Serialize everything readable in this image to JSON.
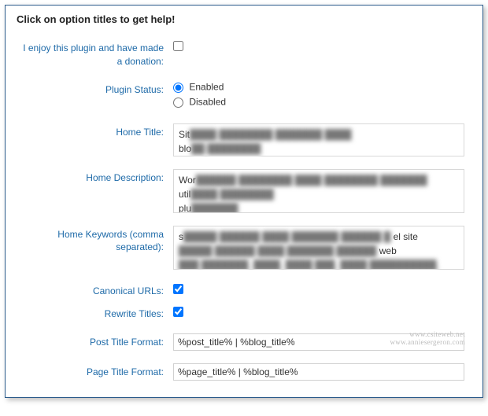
{
  "header": {
    "title": "Click on option titles to get help!"
  },
  "rows": {
    "donation": {
      "label": "I enjoy this plugin and have made a donation:",
      "checked": false
    },
    "plugin_status": {
      "label": "Plugin Status:",
      "options": {
        "enabled": "Enabled",
        "disabled": "Disabled"
      },
      "value": "enabled"
    },
    "home_title": {
      "label": "Home Title:",
      "value_preview": "Sit",
      "value_line2": "blo"
    },
    "home_description": {
      "label": "Home Description:",
      "value_preview": "Wor",
      "value_line2": "util",
      "value_line3": "plu"
    },
    "home_keywords": {
      "label": "Home Keywords (comma separated):",
      "value_preview": "s",
      "suffix1": "el site",
      "suffix2": "web"
    },
    "canonical": {
      "label": "Canonical URLs:",
      "checked": true
    },
    "rewrite": {
      "label": "Rewrite Titles:",
      "checked": true
    },
    "post_title_format": {
      "label": "Post Title Format:",
      "value": "%post_title% | %blog_title%"
    },
    "page_title_format": {
      "label": "Page Title Format:",
      "value": "%page_title% | %blog_title%"
    }
  },
  "watermark": {
    "line1": "www.csiteweb.net",
    "line2": "www.anniesergeron.com"
  }
}
